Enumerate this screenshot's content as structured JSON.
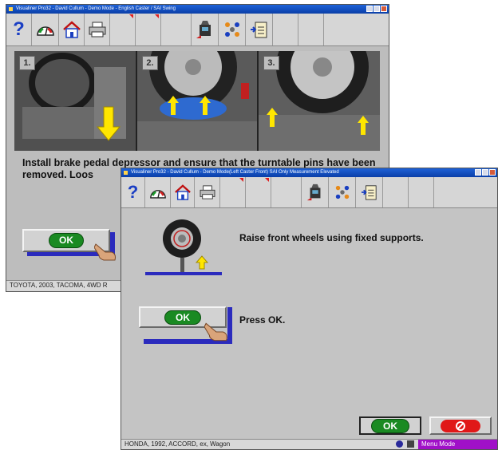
{
  "back_window": {
    "title": "Visualiner Pro32 - David Cullum - Demo Mode - English   Caster / SAI Swing",
    "step_numbers": [
      "1.",
      "2.",
      "3."
    ],
    "instruction": "Install brake pedal depressor and ensure that the turntable pins have been removed. Loos",
    "ok_label": "OK",
    "status": "TOYOTA, 2003, TACOMA, 4WD R"
  },
  "front_window": {
    "title": "Visualiner Pro32 - David Cullum - Demo Mode(Left Caster Front)   SAI Only Measurement Elevated",
    "instruction": "Raise front wheels using fixed supports.",
    "press_ok_text": "Press OK.",
    "ok_label": "OK",
    "status": "HONDA, 1992, ACCORD, ex, Wagon",
    "mode_label": "Menu Mode"
  },
  "colors": {
    "title_blue": "#0a3ea8",
    "ok_green": "#1a8a22",
    "cancel_red": "#e01818",
    "accent_blue": "#2b2bbd",
    "mode_purple": "#a010c8"
  }
}
